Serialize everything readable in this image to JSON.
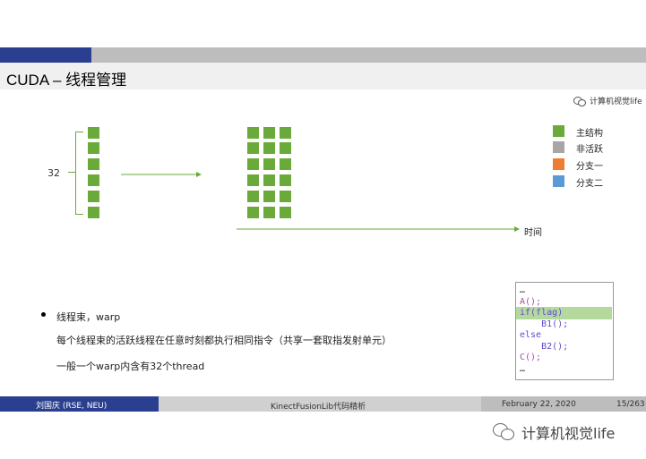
{
  "slide": {
    "title": "CUDA – 线程管理",
    "watermark_top": "计算机视觉life",
    "warp_size_label": "32",
    "time_label": "时间",
    "legend": [
      {
        "label": "主结构",
        "color": "#6aaa3a"
      },
      {
        "label": "非活跃",
        "color": "#a6a6a6"
      },
      {
        "label": "分支一",
        "color": "#ed7d31"
      },
      {
        "label": "分支二",
        "color": "#5b9bd5"
      }
    ],
    "bullet_title": "线程束，warp",
    "bullet_line1": "每个线程束的活跃线程在任意时刻都执行相同指令（共享一套取指发射单元）",
    "bullet_line2": "一般一个warp内含有32个thread",
    "code": [
      {
        "text": "…",
        "color": "#333333"
      },
      {
        "text": "A();",
        "color": "#a64ca6"
      },
      {
        "text": "if(flag)",
        "color": "#5b4bd5"
      },
      {
        "text": "    B1();",
        "color": "#5b4bd5"
      },
      {
        "text": "else",
        "color": "#5b4bd5"
      },
      {
        "text": "    B2();",
        "color": "#5b4bd5"
      },
      {
        "text": "C();",
        "color": "#a64ca6"
      },
      {
        "text": "…",
        "color": "#333333"
      }
    ]
  },
  "footer": {
    "author": "刘国庆 (RSE, NEU)",
    "topic": "KinectFusionLib代码精析",
    "date": "February 22, 2020",
    "page": "15/263"
  },
  "watermark_bottom": "计算机视觉life",
  "colors": {
    "accent_blue": "#2a3f8f",
    "green": "#6aaa3a",
    "arrow": "#6aaa3a"
  }
}
